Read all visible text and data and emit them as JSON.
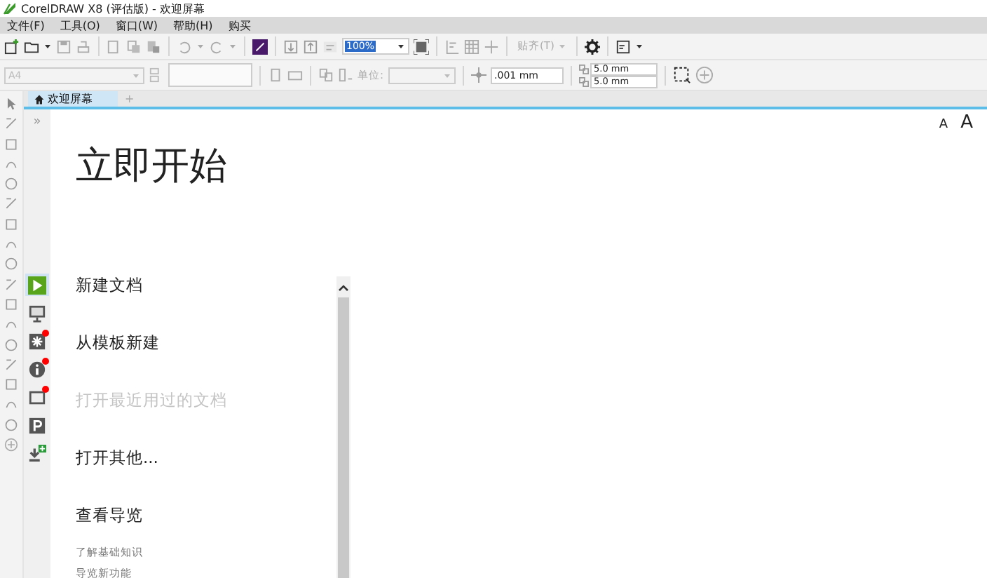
{
  "window": {
    "title": "CorelDRAW X8 (评估版) - 欢迎屏幕"
  },
  "menu": [
    "文件(F)",
    "工具(O)",
    "窗口(W)",
    "帮助(H)",
    "购买"
  ],
  "toolbar": {
    "zoom": "100%",
    "snap": "贴齐(T)",
    "page_size": "A4",
    "units_label": "单位:",
    "nudge": ".001 mm",
    "duplicate": [
      "5.0 mm",
      "5.0 mm"
    ]
  },
  "tabs": [
    {
      "label": "欢迎屏幕",
      "selected": true
    },
    {
      "label": "+",
      "selected": false
    }
  ],
  "nav_collapse": "»",
  "nav_icons": [
    {
      "kind": "play",
      "selected": true,
      "badge": false
    },
    {
      "kind": "monitor",
      "selected": false,
      "badge": false
    },
    {
      "kind": "star",
      "selected": false,
      "badge": true
    },
    {
      "kind": "info",
      "selected": false,
      "badge": true
    },
    {
      "kind": "gallery",
      "selected": false,
      "badge": true
    },
    {
      "kind": "p",
      "selected": false,
      "badge": false
    },
    {
      "kind": "download",
      "selected": false,
      "badge": false
    }
  ],
  "font_size_buttons": [
    "A",
    "A"
  ],
  "heading": "立即开始",
  "links": [
    {
      "label": "新建文档",
      "disabled": false
    },
    {
      "label": "从模板新建",
      "disabled": false
    },
    {
      "label": "打开最近用过的文档",
      "disabled": true
    },
    {
      "label": "打开其他...",
      "disabled": false
    },
    {
      "label": "查看导览",
      "disabled": false
    }
  ],
  "sublinks": [
    "了解基础知识",
    "导览新功能"
  ]
}
